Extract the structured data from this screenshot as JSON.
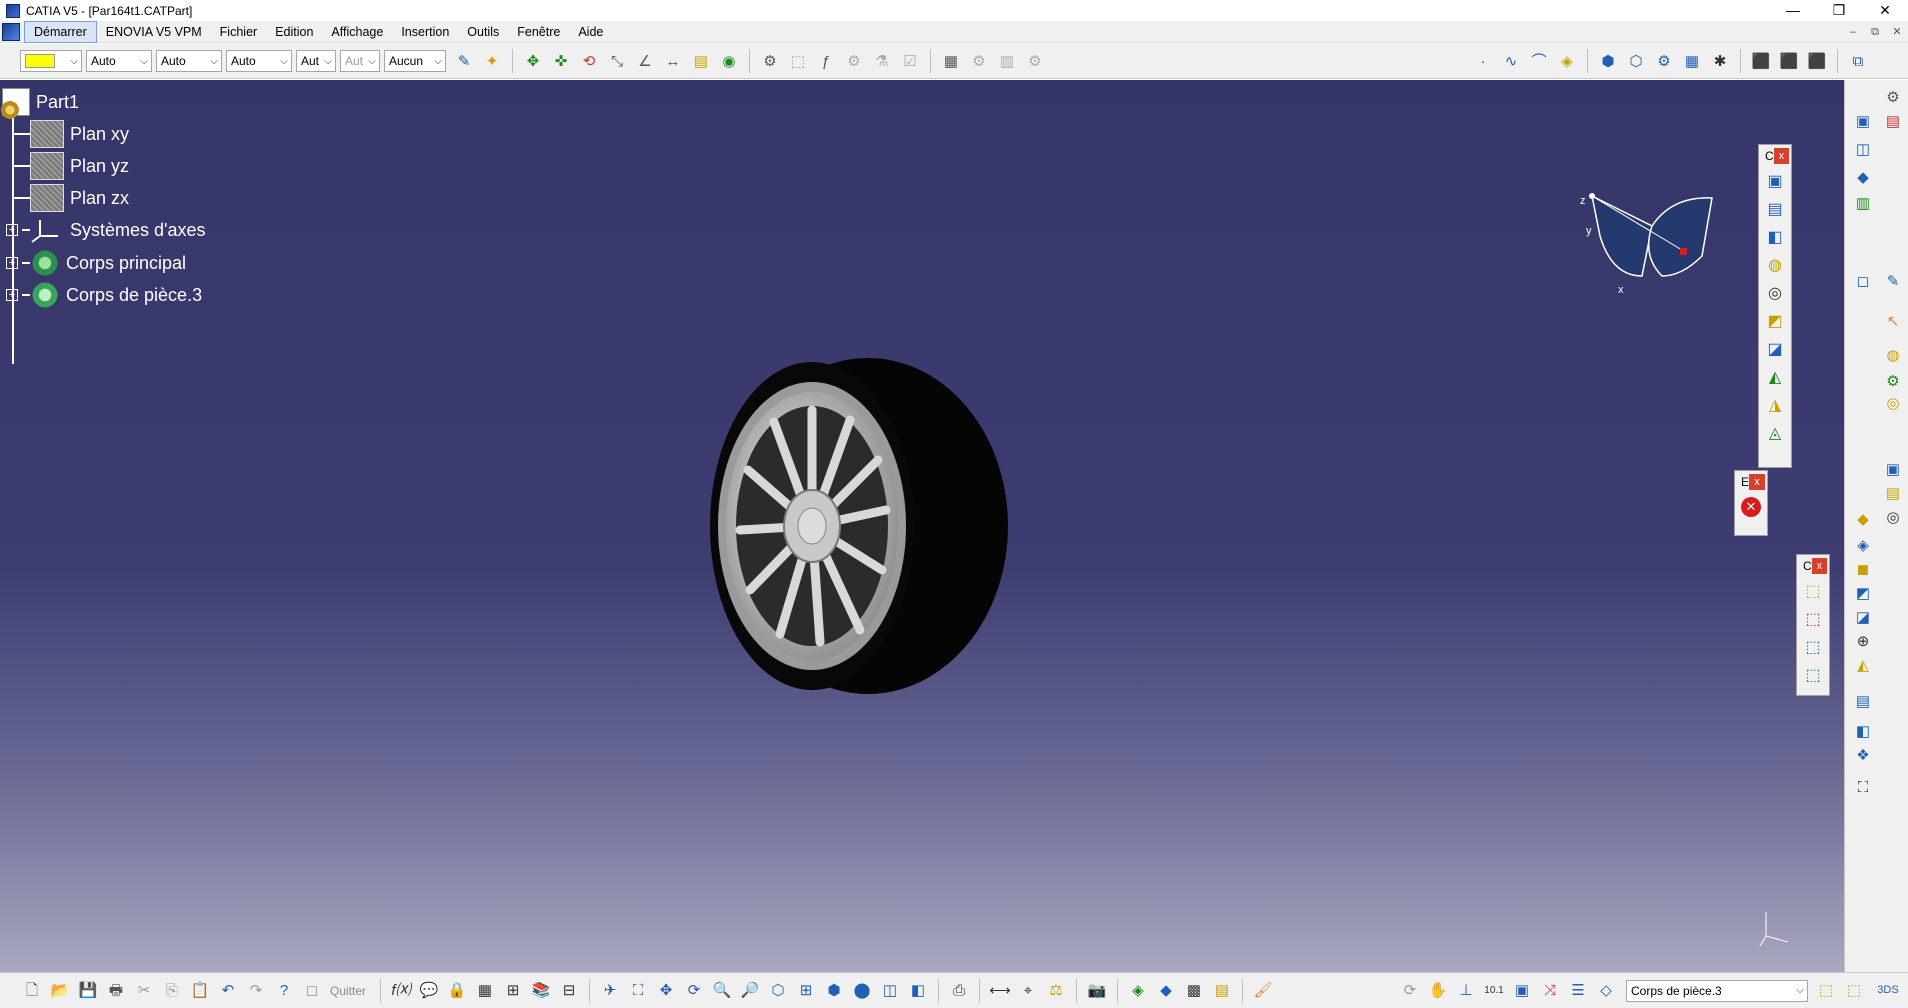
{
  "window": {
    "title": "CATIA V5 - [Par164t1.CATPart]",
    "minimize": "—",
    "maximize": "❐",
    "close": "✕"
  },
  "menu": {
    "items": [
      "Démarrer",
      "ENOVIA V5 VPM",
      "Fichier",
      "Edition",
      "Affichage",
      "Insertion",
      "Outils",
      "Fenêtre",
      "Aide"
    ],
    "mdi": [
      "–",
      "⧉",
      "✕"
    ]
  },
  "toolbar": {
    "color_swatch": "#ffff00",
    "transparency": "Auto",
    "line_thickness": "Auto",
    "line_type": "Auto",
    "point_symbol": "Aut",
    "rendering": "Aut",
    "layer": "Aucun"
  },
  "tree": {
    "root": "Part1",
    "items": [
      {
        "label": "Plan xy",
        "icon": "plane-icon"
      },
      {
        "label": "Plan yz",
        "icon": "plane-icon"
      },
      {
        "label": "Plan zx",
        "icon": "plane-icon"
      },
      {
        "label": "Systèmes d'axes",
        "icon": "axis-system-icon"
      },
      {
        "label": "Corps principal",
        "icon": "part-body-icon"
      },
      {
        "label": "Corps de pièce.3",
        "icon": "body-icon"
      }
    ],
    "expander": "+"
  },
  "compass": {
    "x": "x",
    "y": "y",
    "z": "z"
  },
  "floatbars": {
    "a_title": "C",
    "b_title": "E",
    "c_title": "C",
    "close": "x"
  },
  "bottom": {
    "quit_label": "Quitter",
    "current_body": "Corps de pièce.3"
  },
  "colors": {
    "viewport_top": "#35356a",
    "viewport_bottom": "#a8a8c0",
    "tree_text": "#ffffff",
    "accent_close": "#d9402b"
  }
}
